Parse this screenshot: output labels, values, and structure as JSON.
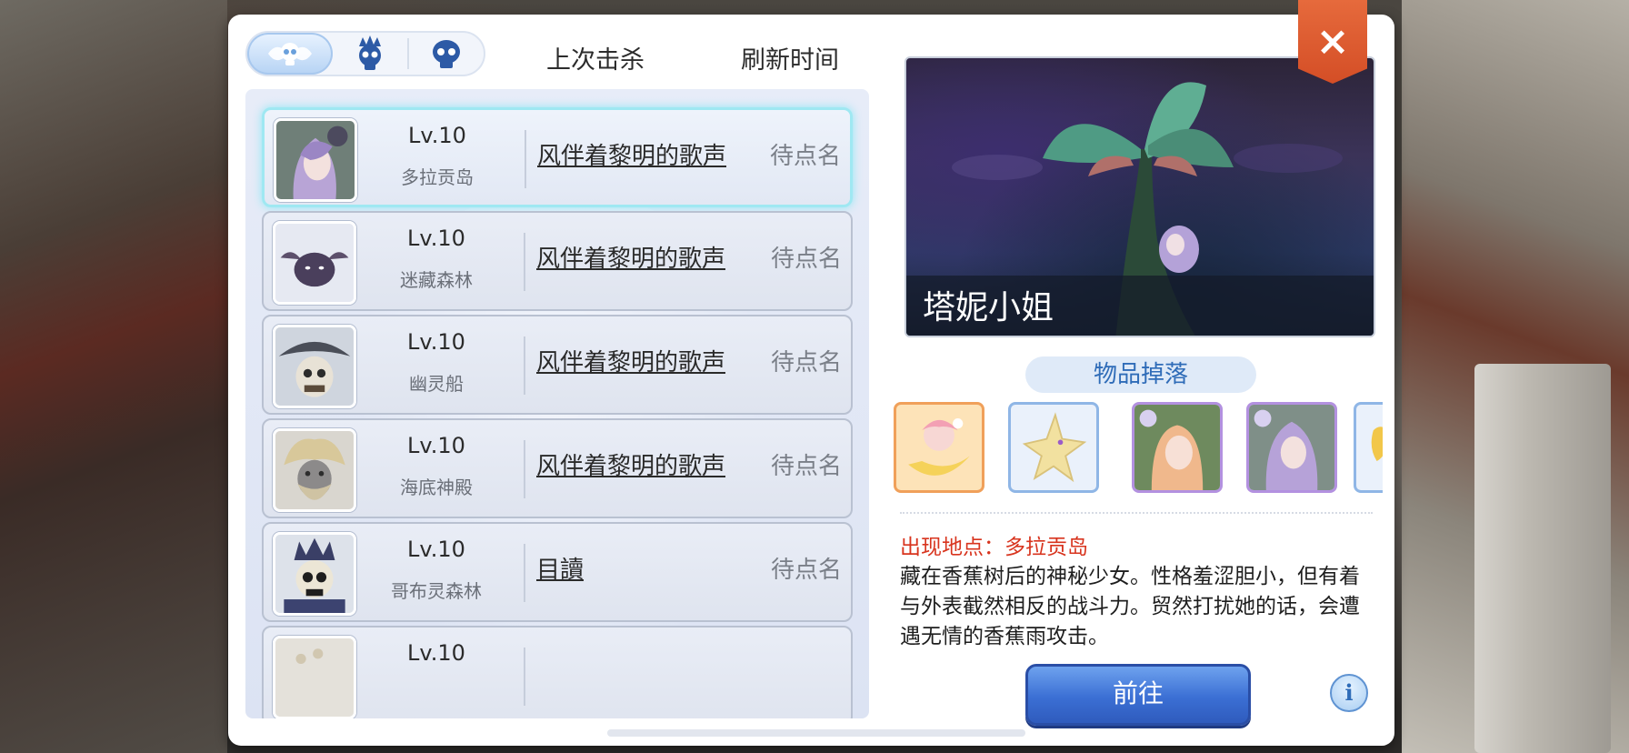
{
  "tabs": [
    {
      "name": "all-bosses-tab",
      "icon": "skull-wings-icon",
      "active": true
    },
    {
      "name": "king-boss-tab",
      "icon": "crowned-skull-icon",
      "active": false
    },
    {
      "name": "skull-boss-tab",
      "icon": "skull-icon",
      "active": false
    }
  ],
  "headers": {
    "last_kill": "上次击杀",
    "refresh_time": "刷新时间"
  },
  "bosses": [
    {
      "level": "Lv.10",
      "map": "多拉贡岛",
      "killer": "风伴着黎明的歌声",
      "time": "待点名",
      "selected": true
    },
    {
      "level": "Lv.10",
      "map": "迷藏森林",
      "killer": "风伴着黎明的歌声",
      "time": "待点名",
      "selected": false
    },
    {
      "level": "Lv.10",
      "map": "幽灵船",
      "killer": "风伴着黎明的歌声",
      "time": "待点名",
      "selected": false
    },
    {
      "level": "Lv.10",
      "map": "海底神殿",
      "killer": "风伴着黎明的歌声",
      "time": "待点名",
      "selected": false
    },
    {
      "level": "Lv.10",
      "map": "哥布灵森林",
      "killer": "目讀",
      "time": "待点名",
      "selected": false
    },
    {
      "level": "Lv.10",
      "map": "",
      "killer": "",
      "time": "",
      "selected": false
    }
  ],
  "detail": {
    "name": "塔妮小姐",
    "drops_label": "物品掉落",
    "location": "出现地点：多拉贡岛",
    "description": "藏在香蕉树后的神秘少女。性格羞涩胆小，但有着与外表截然相反的战斗力。贸然打扰她的话，会遭遇无情的香蕉雨攻击。",
    "go_label": "前往",
    "info_label": "i"
  },
  "drops": [
    {
      "name": "banana-girl-card-icon",
      "border": "#f0a05a",
      "bg": "#fde3b8"
    },
    {
      "name": "star-item-icon",
      "border": "#8fb6e6",
      "bg": "#eaf1fb"
    },
    {
      "name": "miss-tani-card-icon",
      "border": "#b391e0",
      "bg": "#efe5fb"
    },
    {
      "name": "purple-hair-card-icon",
      "border": "#b391e0",
      "bg": "#efe5fb"
    },
    {
      "name": "gold-item-icon",
      "border": "#8fb6e6",
      "bg": "#eaf1fb"
    }
  ],
  "colors": {
    "accent_blue": "#3b6fd4",
    "close_orange": "#d44e26",
    "location_red": "#d8341e",
    "selected_glow": "#9fe8f2"
  }
}
